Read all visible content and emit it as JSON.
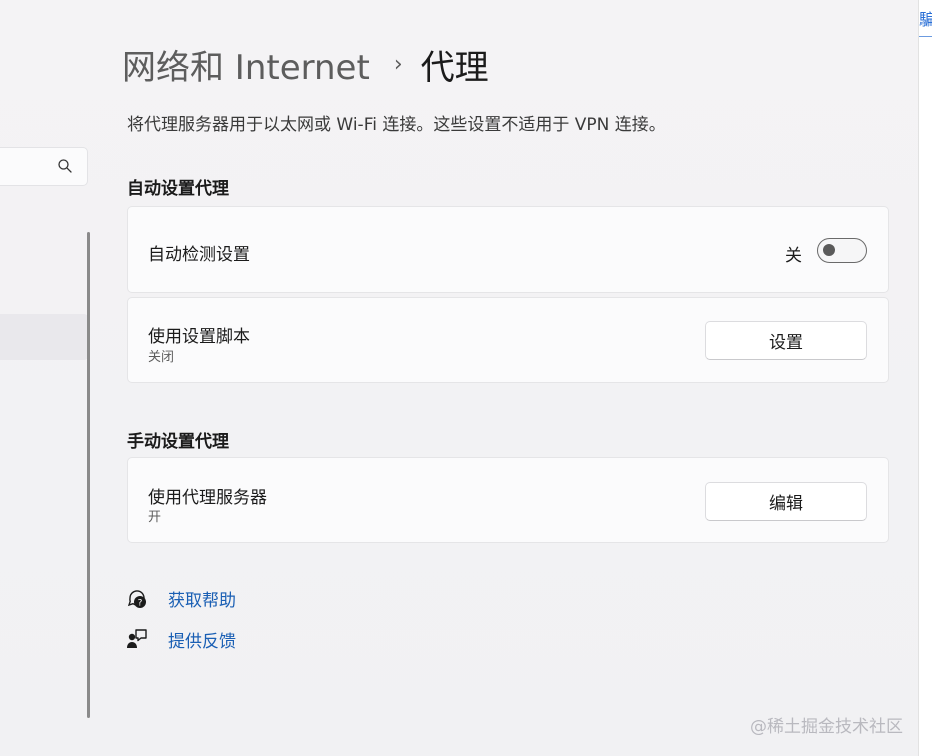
{
  "header": {
    "breadcrumb_parent": "网络和 Internet",
    "breadcrumb_separator": "›",
    "breadcrumb_current": "代理",
    "description": "将代理服务器用于以太网或 Wi-Fi 连接。这些设置不适用于 VPN 连接。"
  },
  "right_strip": {
    "peek_text": "騙"
  },
  "auto_section": {
    "title": "自动设置代理",
    "detect": {
      "label": "自动检测设置",
      "toggle_state_text": "关",
      "toggle_on": false
    },
    "script": {
      "label": "使用设置脚本",
      "status": "关闭",
      "button_label": "设置"
    }
  },
  "manual_section": {
    "title": "手动设置代理",
    "proxy": {
      "label": "使用代理服务器",
      "status": "开",
      "button_label": "编辑"
    }
  },
  "links": {
    "help": "获取帮助",
    "feedback": "提供反馈"
  },
  "icons": {
    "search": "search-icon",
    "help": "help-chat-icon",
    "feedback": "feedback-person-icon"
  },
  "colors": {
    "link": "#1a5fb4",
    "toggle_knob": "#5a5a5a"
  },
  "watermark": "@稀土掘金技术社区"
}
